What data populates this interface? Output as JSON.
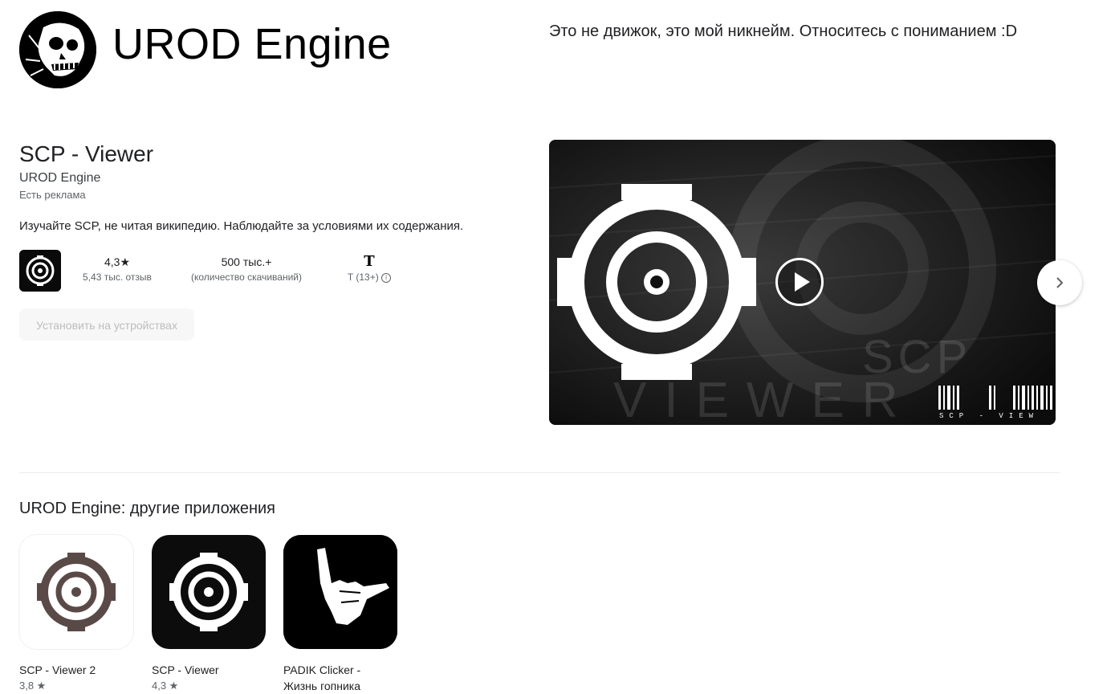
{
  "developer": {
    "name": "UROD Engine",
    "description": "Это не движок, это мой никнейм. Относитесь с пониманием :D",
    "avatar_icon": "skull-avatar-icon"
  },
  "app": {
    "title": "SCP - Viewer",
    "developer": "UROD Engine",
    "ads_note": "Есть реклама",
    "description": "Изучайте SCP, не читая википедию. Наблюдайте за условиями их содержания.",
    "rating_value": "4,3★",
    "rating_count": "5,43 тыс. отзыв",
    "downloads_value": "500 тыс.+",
    "downloads_label": "(количество скачиваний)",
    "age_badge": "T",
    "age_label": "T (13+)",
    "info_icon": "info-icon",
    "install_label": "Установить на устройствах"
  },
  "media": {
    "play_icon": "play-icon",
    "next_icon": "chevron-right-icon",
    "watermark_top": "SCP",
    "watermark_bottom": "VIEWER",
    "barcode_text": "SCP - VIEW"
  },
  "other_apps": {
    "title": "UROD Engine: другие приложения",
    "items": [
      {
        "name": "SCP - Viewer 2",
        "rating": "3,8 ★"
      },
      {
        "name": "SCP - Viewer",
        "rating": "4,3 ★"
      },
      {
        "name": "PADIK Clicker - Жизнь гопника",
        "rating": ""
      }
    ]
  },
  "colors": {
    "accent": "#01875f",
    "text": "#202124",
    "muted": "#5f6368",
    "scp_brown": "#5a4a47"
  }
}
